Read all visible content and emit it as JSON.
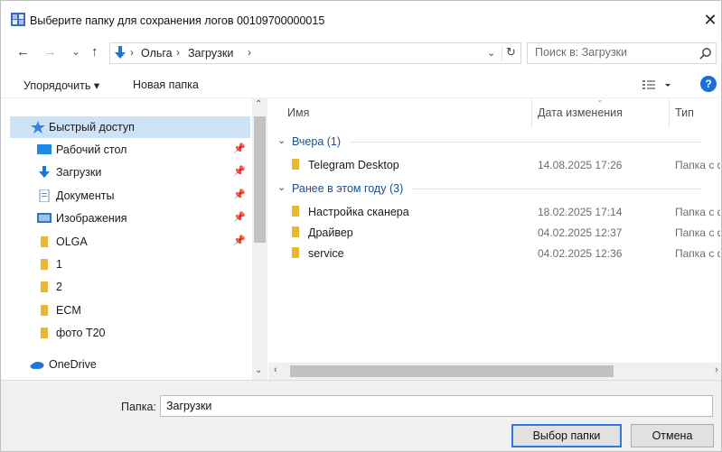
{
  "window": {
    "title": "Выберите папку для сохранения логов 00109700000015",
    "close_glyph": "✕"
  },
  "address_bar": {
    "crumbs": [
      "Ольга",
      "Загрузки"
    ],
    "separator": "›"
  },
  "search": {
    "placeholder": "Поиск в: Загрузки"
  },
  "toolbar": {
    "organize_label": "Упорядочить ▾",
    "new_folder_label": "Новая папка",
    "help_label": "?"
  },
  "nav_pane": {
    "quick_access": "Быстрый доступ",
    "items": [
      {
        "label": "Рабочий стол",
        "icon": "desktop-icon",
        "pinned": true
      },
      {
        "label": "Загрузки",
        "icon": "downloads-icon",
        "pinned": true
      },
      {
        "label": "Документы",
        "icon": "documents-icon",
        "pinned": true
      },
      {
        "label": "Изображения",
        "icon": "pictures-icon",
        "pinned": true
      },
      {
        "label": "OLGA",
        "icon": "folder-icon",
        "pinned": true
      },
      {
        "label": "1",
        "icon": "folder-icon",
        "pinned": false
      },
      {
        "label": "2",
        "icon": "folder-icon",
        "pinned": false
      },
      {
        "label": "ECM",
        "icon": "folder-icon",
        "pinned": false
      },
      {
        "label": "фото Т20",
        "icon": "folder-icon",
        "pinned": false
      }
    ],
    "onedrive": "OneDrive"
  },
  "file_list": {
    "columns": {
      "name": "Имя",
      "date": "Дата изменения",
      "type": "Тип"
    },
    "groups": [
      {
        "label": "Вчера (1)",
        "rows": [
          {
            "name": "Telegram Desktop",
            "date": "14.08.2025 17:26",
            "type": "Папка с файлами"
          }
        ]
      },
      {
        "label": "Ранее в этом году (3)",
        "rows": [
          {
            "name": "Настройка сканера",
            "date": "18.02.2025 17:14",
            "type": "Папка с файлами"
          },
          {
            "name": "Драйвер",
            "date": "04.02.2025 12:37",
            "type": "Папка с файлами"
          },
          {
            "name": "service",
            "date": "04.02.2025 12:36",
            "type": "Папка с файлами"
          }
        ]
      }
    ]
  },
  "bottom": {
    "folder_label": "Папка:",
    "folder_value": "Загрузки",
    "select_button": "Выбор папки",
    "cancel_button": "Отмена"
  },
  "colors": {
    "selection": "#cde3f5",
    "accent": "#1c6fd8",
    "folder": "#e8b930",
    "group_text": "#1e4e8c"
  }
}
